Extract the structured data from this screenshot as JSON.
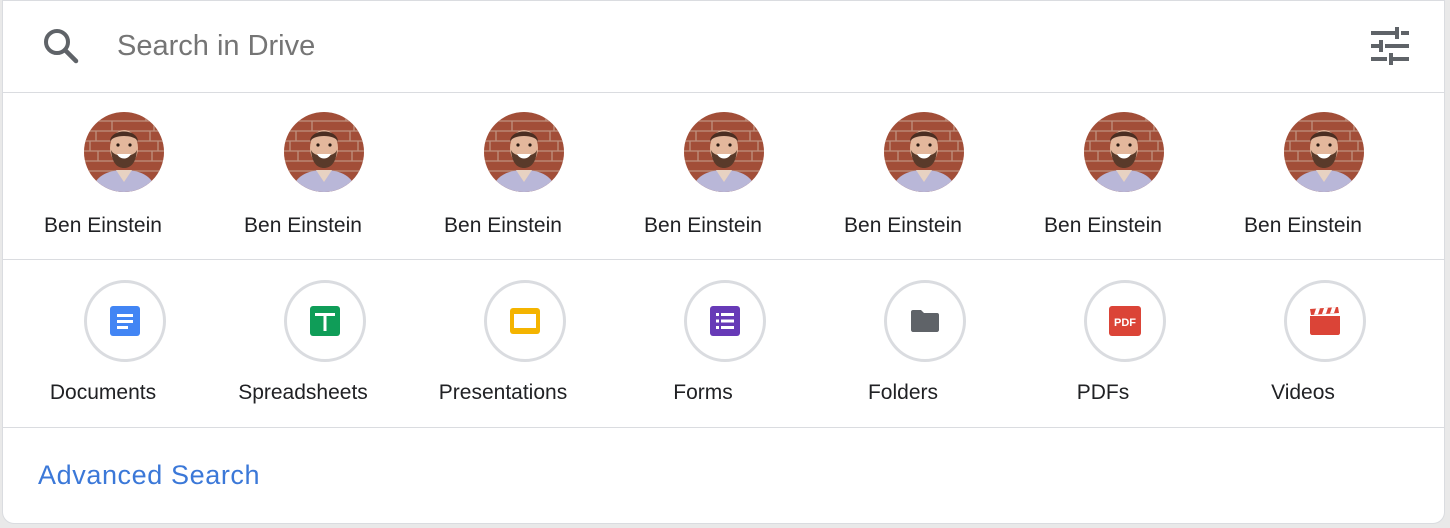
{
  "search": {
    "placeholder": "Search in Drive",
    "icon": "search-icon",
    "options_icon": "tune-icon"
  },
  "people": [
    {
      "name": "Ben Einstein"
    },
    {
      "name": "Ben Einstein"
    },
    {
      "name": "Ben Einstein"
    },
    {
      "name": "Ben Einstein"
    },
    {
      "name": "Ben Einstein"
    },
    {
      "name": "Ben Einstein"
    },
    {
      "name": "Ben Einstein"
    }
  ],
  "file_types": [
    {
      "label": "Documents",
      "icon": "docs-icon",
      "color": "#4285f4"
    },
    {
      "label": "Spreadsheets",
      "icon": "sheets-icon",
      "color": "#0f9d58"
    },
    {
      "label": "Presentations",
      "icon": "slides-icon",
      "color": "#f4b400"
    },
    {
      "label": "Forms",
      "icon": "forms-icon",
      "color": "#673ab7"
    },
    {
      "label": "Folders",
      "icon": "folder-icon",
      "color": "#5f6368"
    },
    {
      "label": "PDFs",
      "icon": "pdf-icon",
      "color": "#db4437"
    },
    {
      "label": "Videos",
      "icon": "video-icon",
      "color": "#db4437"
    }
  ],
  "footer": {
    "advanced_search_label": "Advanced Search",
    "link_color": "#3b78d8"
  }
}
